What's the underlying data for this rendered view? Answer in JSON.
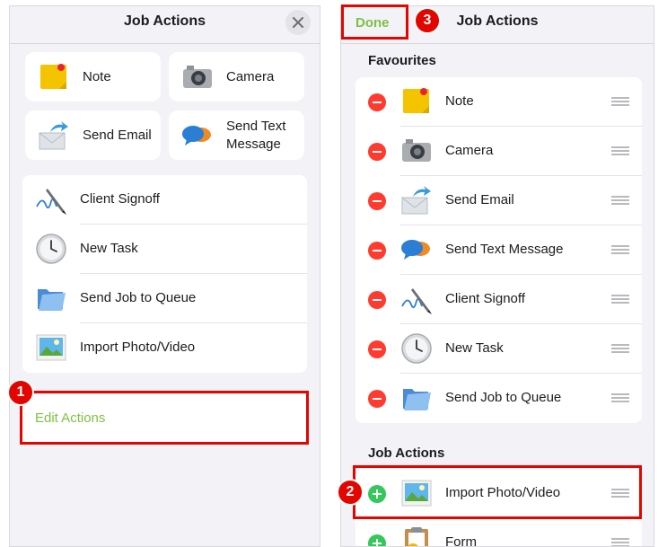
{
  "left": {
    "title": "Job Actions",
    "tiles": [
      {
        "label": "Note",
        "icon": "sticky-note-icon"
      },
      {
        "label": "Camera",
        "icon": "camera-icon"
      },
      {
        "label": "Send Email",
        "icon": "email-icon"
      },
      {
        "label": "Send Text Message",
        "icon": "chat-bubbles-icon"
      }
    ],
    "list": [
      {
        "label": "Client Signoff",
        "icon": "signature-pen-icon"
      },
      {
        "label": "New Task",
        "icon": "clock-icon"
      },
      {
        "label": "Send Job to Queue",
        "icon": "folder-icon"
      },
      {
        "label": "Import Photo/Video",
        "icon": "photo-icon"
      }
    ],
    "edit_label": "Edit Actions"
  },
  "right": {
    "title": "Job Actions",
    "done_label": "Done",
    "favourites_heading": "Favourites",
    "favourites": [
      {
        "label": "Note",
        "icon": "sticky-note-icon"
      },
      {
        "label": "Camera",
        "icon": "camera-icon"
      },
      {
        "label": "Send Email",
        "icon": "email-icon"
      },
      {
        "label": "Send Text Message",
        "icon": "chat-bubbles-icon"
      },
      {
        "label": "Client Signoff",
        "icon": "signature-pen-icon"
      },
      {
        "label": "New Task",
        "icon": "clock-icon"
      },
      {
        "label": "Send Job to Queue",
        "icon": "folder-icon"
      }
    ],
    "actions_heading": "Job Actions",
    "actions": [
      {
        "label": "Import Photo/Video",
        "icon": "photo-icon"
      },
      {
        "label": "Form",
        "icon": "form-clipboard-icon"
      }
    ]
  },
  "callouts": {
    "one": "1",
    "two": "2",
    "three": "3"
  },
  "colors": {
    "accent_green": "#7dc243",
    "callout_red": "#e10600",
    "delete_red": "#ff3b30",
    "add_green": "#34c759"
  }
}
